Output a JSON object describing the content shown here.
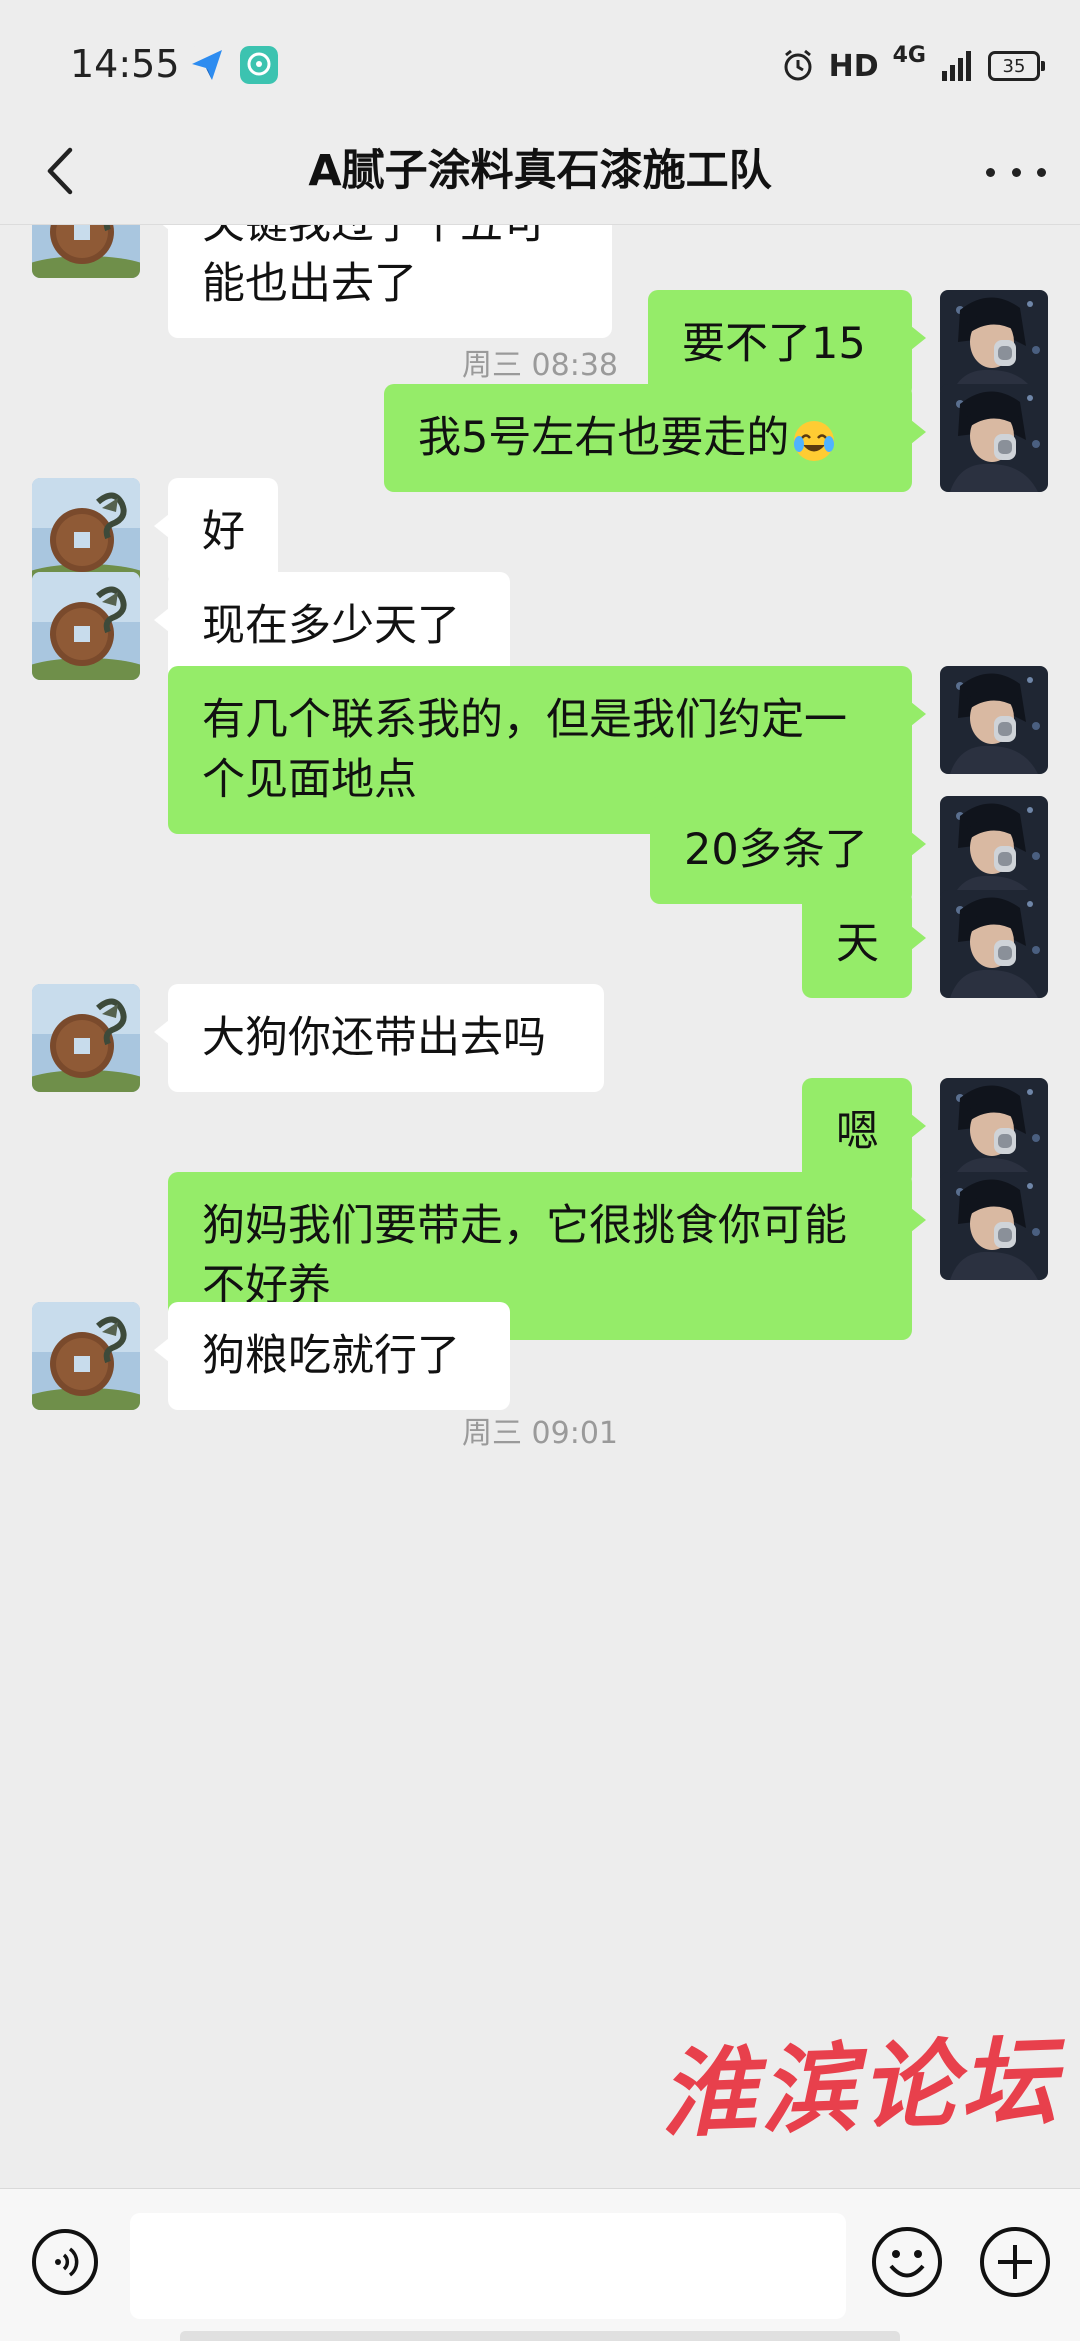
{
  "status_bar": {
    "time": "14:55",
    "hd": "HD",
    "network": "4G",
    "battery": "35",
    "icons": [
      "send-app-icon",
      "chat-app-icon",
      "alarm-icon",
      "signal-icon",
      "battery-icon"
    ]
  },
  "nav": {
    "title": "A腻子涂料真石漆施工队",
    "back_icon": "chevron-left-icon",
    "more_icon": "more-dots-icon"
  },
  "messages": [
    {
      "side": "left",
      "text": "关键我过了十五可能也出去了"
    },
    {
      "type": "time",
      "text": "周三 08:38"
    },
    {
      "side": "right",
      "text": "要不了15"
    },
    {
      "side": "right",
      "text": "我5号左右也要走的",
      "emoji": "face-with-tears-of-joy"
    },
    {
      "side": "left",
      "text": "好"
    },
    {
      "side": "left",
      "text": "现在多少天了"
    },
    {
      "side": "right",
      "text": "有几个联系我的，但是我们约定一个见面地点"
    },
    {
      "side": "right",
      "text": "20多条了"
    },
    {
      "side": "right",
      "text": "天"
    },
    {
      "side": "left",
      "text": "大狗你还带出去吗"
    },
    {
      "side": "right",
      "text": "嗯"
    },
    {
      "side": "right",
      "text": "狗妈我们要带走，它很挑食你可能不好养"
    },
    {
      "side": "left",
      "text": "狗粮吃就行了"
    },
    {
      "type": "time",
      "text": "周三 09:01"
    }
  ],
  "watermark": "淮滨论坛",
  "input_bar": {
    "voice_icon": "voice-icon",
    "text_value": "",
    "emoji_icon": "emoji-icon",
    "plus_icon": "plus-icon"
  },
  "colors": {
    "background": "#ededed",
    "sent_bubble": "#95ec69",
    "received_bubble": "#ffffff",
    "watermark": "#e8323f"
  }
}
